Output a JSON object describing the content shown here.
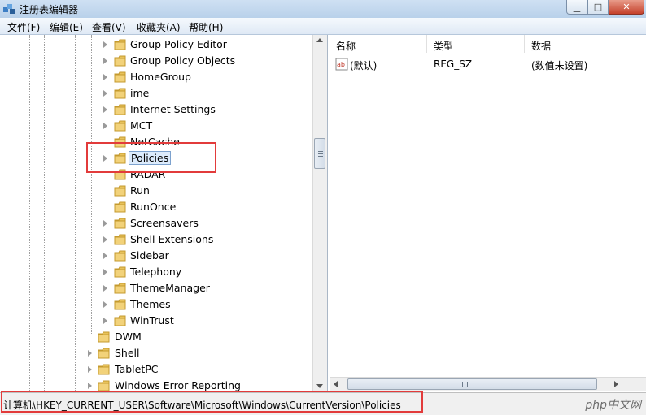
{
  "window": {
    "title": "注册表编辑器",
    "min_icon": "minimize-icon",
    "max_icon": "maximize-icon",
    "close_icon": "close-icon"
  },
  "menu": [
    "文件(F)",
    "编辑(E)",
    "查看(V)",
    "收藏夹(A)",
    "帮助(H)"
  ],
  "tree": {
    "nested_items": [
      "Group Policy Editor",
      "Group Policy Objects",
      "HomeGroup",
      "ime",
      "Internet Settings",
      "MCT",
      "NetCache",
      "Policies",
      "RADAR",
      "Run",
      "RunOnce",
      "Screensavers",
      "Shell Extensions",
      "Sidebar",
      "Telephony",
      "ThemeManager",
      "Themes",
      "WinTrust"
    ],
    "selected": "Policies",
    "parent_items": [
      "DWM",
      "Shell",
      "TabletPC",
      "Windows Error Reporting"
    ]
  },
  "list": {
    "columns": [
      "名称",
      "类型",
      "数据"
    ],
    "rows": [
      {
        "name": "(默认)",
        "type": "REG_SZ",
        "data": "(数值未设置)"
      }
    ]
  },
  "status": {
    "path": "计算机\\HKEY_CURRENT_USER\\Software\\Microsoft\\Windows\\CurrentVersion\\Policies"
  },
  "watermark": "php中文网",
  "colors": {
    "highlight_box": "#e23b3b",
    "folder": "#e8c25a",
    "selection": "#dcebfc"
  }
}
